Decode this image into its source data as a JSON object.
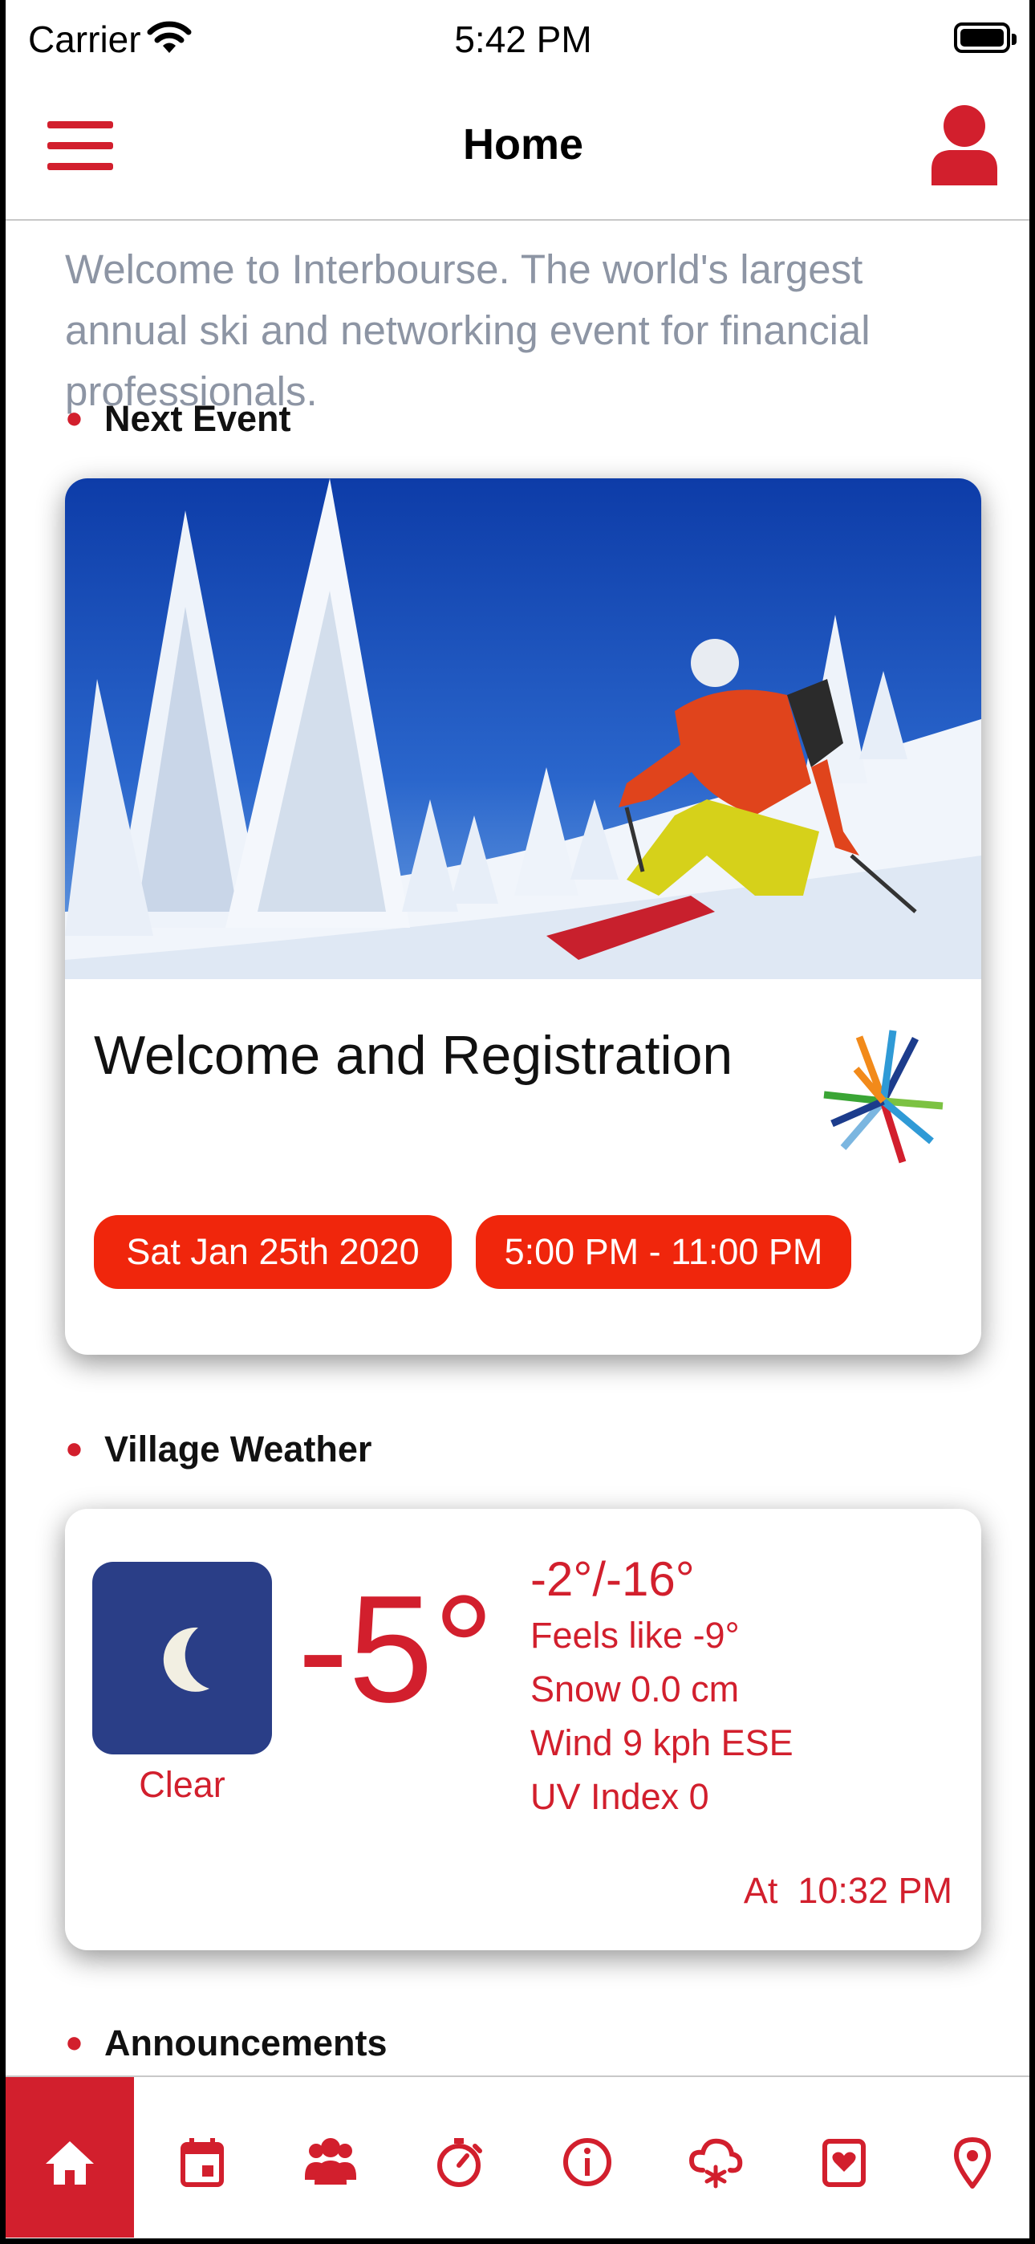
{
  "status_bar": {
    "carrier": "Carrier",
    "time": "5:42 PM"
  },
  "nav": {
    "title": "Home"
  },
  "intro": {
    "text": "Welcome to Interbourse. The world's largest annual ski and networking event for financial professionals."
  },
  "sections": {
    "next_event": "Next Event",
    "village_weather": "Village Weather",
    "announcements": "Announcements"
  },
  "event": {
    "title": "Welcome and Registration",
    "date": "Sat Jan 25th 2020",
    "time": "5:00 PM - 11:00 PM"
  },
  "weather": {
    "temperature": "-5°",
    "condition": "Clear",
    "high_low": "-2°/-16°",
    "feels_like": "Feels like -9°",
    "snow": "Snow 0.0 cm",
    "wind": "Wind 9 kph ESE",
    "uv": "UV Index 0",
    "observed_at": "At  10:32 PM"
  },
  "tab_bar": {
    "active": "home",
    "items": [
      {
        "id": "home",
        "icon": "home-icon"
      },
      {
        "id": "calendar",
        "icon": "calendar-icon"
      },
      {
        "id": "people",
        "icon": "people-icon"
      },
      {
        "id": "timer",
        "icon": "stopwatch-icon"
      },
      {
        "id": "info",
        "icon": "info-icon"
      },
      {
        "id": "snow",
        "icon": "snow-cloud-icon"
      },
      {
        "id": "favorites",
        "icon": "heart-card-icon"
      },
      {
        "id": "location",
        "icon": "location-pin-icon"
      }
    ]
  },
  "colors": {
    "brand_red": "#d21f2d",
    "pill_red": "#f0260c",
    "weather_tile": "#2a3e87",
    "intro_text": "#8d95a4"
  }
}
